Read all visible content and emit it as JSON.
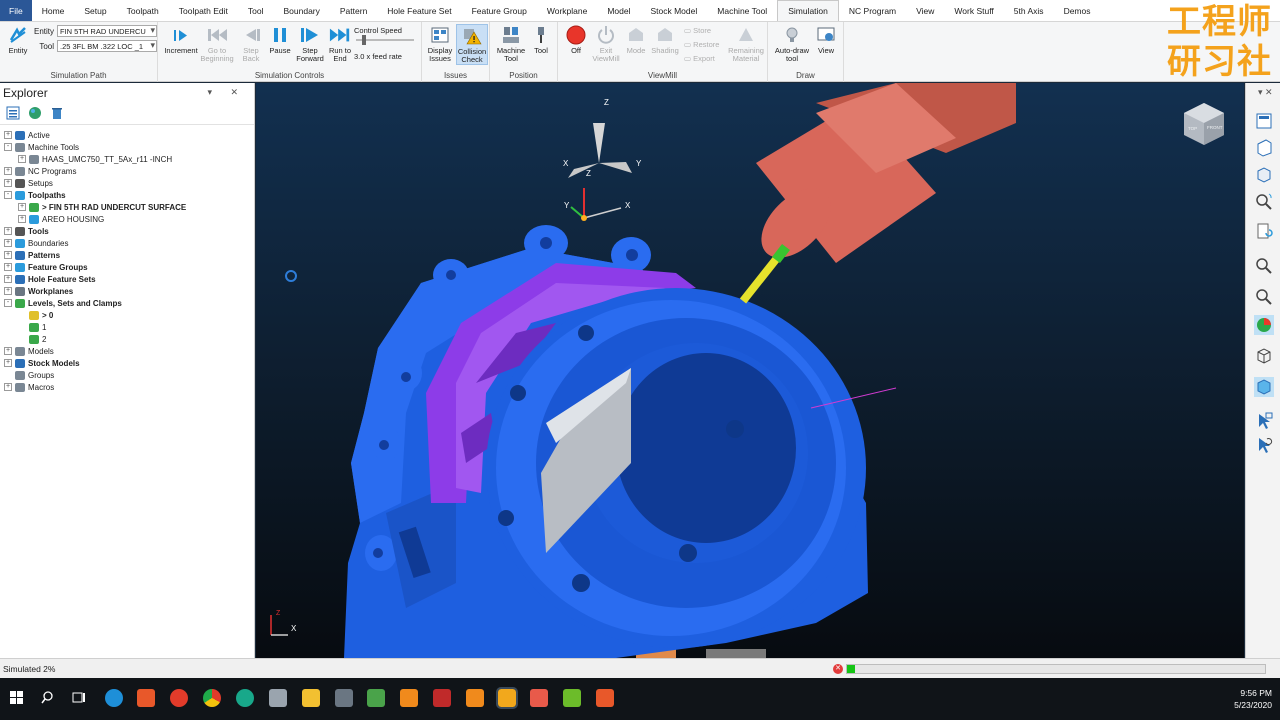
{
  "tabs": [
    "File",
    "Home",
    "Setup",
    "Toolpath",
    "Toolpath Edit",
    "Tool",
    "Boundary",
    "Pattern",
    "Hole Feature Set",
    "Feature Group",
    "Workplane",
    "Model",
    "Stock Model",
    "Machine Tool",
    "Simulation",
    "NC Program",
    "View",
    "Work Stuff",
    "5th Axis",
    "Demos"
  ],
  "active_tab": "Simulation",
  "ribbon": {
    "simulation_path": {
      "title": "Simulation Path",
      "entity_button": "Entity",
      "entity_label": "Entity",
      "entity_value": "FIN 5TH RAD UNDERCU",
      "tool_label": "Tool",
      "tool_value": ".25 3FL BM .322 LOC _1"
    },
    "simulation_controls": {
      "title": "Simulation Controls",
      "increment": "Increment",
      "go_to_beginning": "Go to Beginning",
      "step_back": "Step Back",
      "pause": "Pause",
      "step_forward": "Step Forward",
      "run_to_end": "Run to End",
      "control_speed": "Control Speed",
      "feed_rate": "3.0 x feed rate"
    },
    "issues": {
      "title": "Issues",
      "display_issues": "Display Issues",
      "collision_check": "Collision Check"
    },
    "position": {
      "title": "Position",
      "machine_tool": "Machine Tool",
      "tool": "Tool"
    },
    "viewmill": {
      "title": "ViewMill",
      "off": "Off",
      "exit_viewmill": "Exit ViewMill",
      "mode": "Mode",
      "shading": "Shading",
      "store": "Store",
      "restore": "Restore",
      "export": "Export",
      "remaining_material": "Remaining Material"
    },
    "draw": {
      "title": "Draw",
      "auto_draw_tool": "Auto-draw tool",
      "view": "View"
    }
  },
  "watermark": {
    "line1": "工程师",
    "line2": "研习社"
  },
  "explorer": {
    "title": "Explorer",
    "tree": [
      {
        "label": "Active",
        "bold": false
      },
      {
        "label": "Machine Tools",
        "bold": false
      },
      {
        "label": "HAAS_UMC750_TT_5Ax_r11 -INCH",
        "bold": false
      },
      {
        "label": "NC Programs",
        "bold": false
      },
      {
        "label": "Setups",
        "bold": false
      },
      {
        "label": "Toolpaths",
        "bold": true
      },
      {
        "label": "> FIN 5TH RAD UNDERCUT SURFACE",
        "bold": true
      },
      {
        "label": "AREO HOUSING",
        "bold": false
      },
      {
        "label": "Tools",
        "bold": true
      },
      {
        "label": "Boundaries",
        "bold": false
      },
      {
        "label": "Patterns",
        "bold": true
      },
      {
        "label": "Feature Groups",
        "bold": true
      },
      {
        "label": "Hole Feature Sets",
        "bold": true
      },
      {
        "label": "Workplanes",
        "bold": true
      },
      {
        "label": "Levels, Sets and Clamps",
        "bold": true
      },
      {
        "label": "> 0",
        "bold": true
      },
      {
        "label": "1",
        "bold": false
      },
      {
        "label": "2",
        "bold": false
      },
      {
        "label": "Models",
        "bold": false
      },
      {
        "label": "Stock Models",
        "bold": true
      },
      {
        "label": "Groups",
        "bold": false
      },
      {
        "label": "Macros",
        "bold": false
      }
    ]
  },
  "viewport": {
    "axis_labels": {
      "z": "Z",
      "y": "Y",
      "x": "X"
    },
    "viewcube": {
      "top": "TOP",
      "front": "FRONT"
    }
  },
  "status": {
    "text": "Simulated 2%",
    "progress_fraction": 0.02
  },
  "taskbar": {
    "time": "9:56 PM",
    "date": "5/23/2020"
  },
  "colors": {
    "part": "#1e5fe0",
    "machined": "#8d3ce8",
    "spindle": "#d8675a",
    "tool": "#e6e22c",
    "progress": "#14c414"
  }
}
